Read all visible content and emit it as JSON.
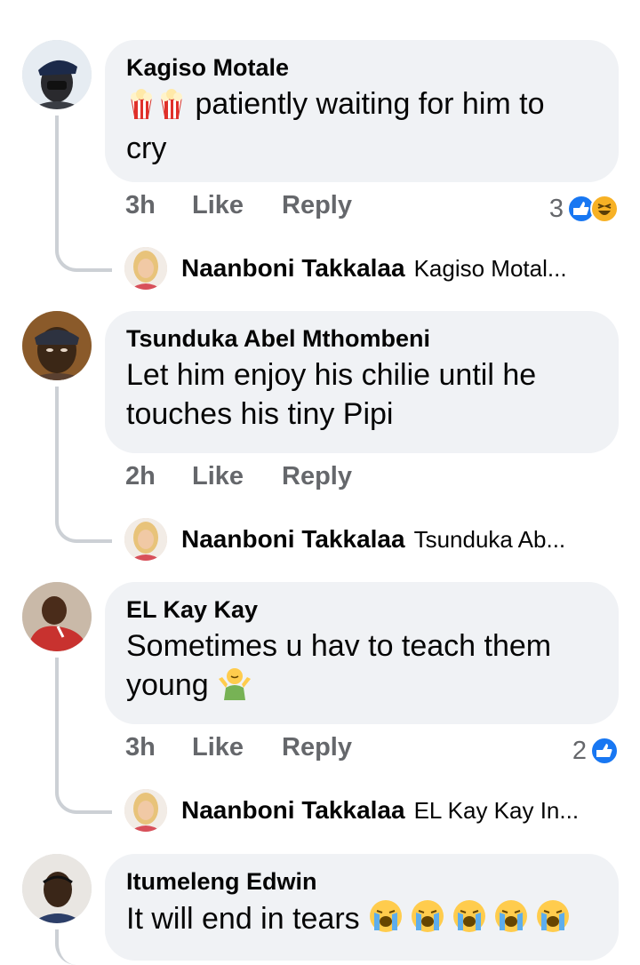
{
  "comments": [
    {
      "author": "Kagiso Motale",
      "text_line1": " patiently waiting for him to",
      "text_line2": "cry",
      "time": "3h",
      "like": "Like",
      "reply": "Reply",
      "reaction_count": "3",
      "reactions": [
        "like-icon",
        "haha-icon"
      ],
      "emoji": "popcorn-icon",
      "reply_author": "Naanboni Takkalaa",
      "reply_preview": "Kagiso Motal..."
    },
    {
      "author": "Tsunduka Abel Mthombeni",
      "text_line1": "Let him enjoy his chilie until he",
      "text_line2": "touches his tiny Pipi",
      "time": "2h",
      "like": "Like",
      "reply": "Reply",
      "reply_author": "Naanboni Takkalaa",
      "reply_preview": "Tsunduka Ab..."
    },
    {
      "author": "EL Kay Kay",
      "text_line1": "Sometimes u hav to teach them",
      "text_line2": "young ",
      "time": "3h",
      "like": "Like",
      "reply": "Reply",
      "reaction_count": "2",
      "reactions": [
        "like-icon"
      ],
      "emoji": "person-shrugging-icon",
      "reply_author": "Naanboni Takkalaa",
      "reply_preview": "EL Kay Kay In..."
    },
    {
      "author": "Itumeleng Edwin",
      "text_line1": "It will end in tears ",
      "emoji": "loudly-crying-face-icon"
    }
  ],
  "colors": {
    "bubble": "#f0f2f5",
    "meta": "#65676b",
    "like_blue": "#1877f2",
    "haha_yellow": "#f7b125",
    "thread_line": "#ccd0d5"
  }
}
